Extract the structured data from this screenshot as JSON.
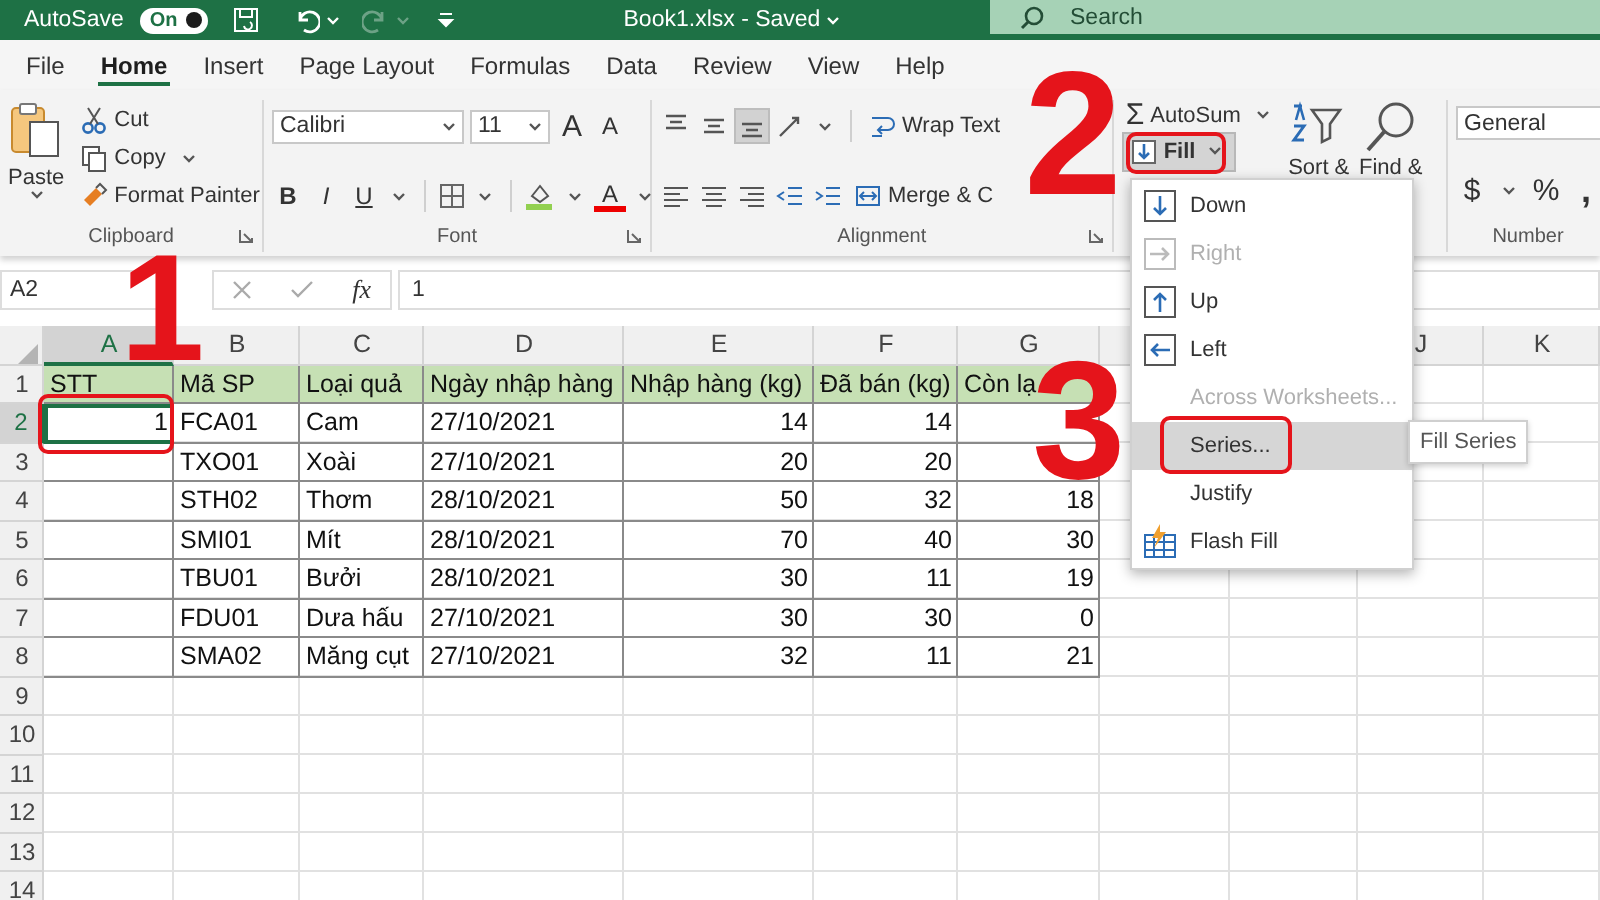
{
  "title_bar": {
    "autosave": {
      "label": "AutoSave",
      "toggle": "On",
      "on": true
    },
    "redo": {
      "disabled": true
    },
    "file_name": "Book1.xlsx - Saved",
    "search": {
      "placeholder": "Search"
    }
  },
  "tabs": [
    {
      "label": "File",
      "selected": false
    },
    {
      "label": "Home",
      "selected": true
    },
    {
      "label": "Insert",
      "selected": false
    },
    {
      "label": "Page Layout",
      "selected": false
    },
    {
      "label": "Formulas",
      "selected": false
    },
    {
      "label": "Data",
      "selected": false
    },
    {
      "label": "Review",
      "selected": false
    },
    {
      "label": "View",
      "selected": false
    },
    {
      "label": "Help",
      "selected": false
    }
  ],
  "ribbon": {
    "clipboard": {
      "label": "Clipboard",
      "paste": "Paste",
      "cut": "Cut",
      "copy": "Copy",
      "format_painter": "Format Painter"
    },
    "font": {
      "label": "Font",
      "font_name": "Calibri",
      "font_size": "11",
      "grow": "A",
      "shrink": "A",
      "bold": "B",
      "italic": "I",
      "underline": "U",
      "font_color": "A"
    },
    "alignment": {
      "label": "Alignment",
      "vertical": [
        {
          "kind": "top",
          "selected": false
        },
        {
          "kind": "middle",
          "selected": false
        },
        {
          "kind": "bottom",
          "selected": true
        }
      ],
      "wrap_text": "Wrap Text",
      "merge": "Merge & C"
    },
    "editing": {
      "autosum_symbol": "Σ",
      "autosum": "AutoSum",
      "fill": {
        "label": "Fill",
        "pressed": true
      },
      "sort": "Sort &",
      "find": "Find &"
    },
    "number": {
      "label": "Number",
      "format": "General",
      "currency": "$",
      "percent": "%",
      "comma": ","
    }
  },
  "formula_bar": {
    "name_box": "A2",
    "fx": "fx",
    "value": "1"
  },
  "sheet": {
    "columns": [
      "A",
      "B",
      "C",
      "D",
      "E",
      "F",
      "G"
    ],
    "columns_right": [
      "J",
      "K"
    ],
    "rows": [
      {
        "number": "1",
        "cells": [
          {
            "text": "STT",
            "kind": "header",
            "selected": false
          },
          {
            "text": "Mã SP",
            "kind": "header",
            "selected": false
          },
          {
            "text": "Loại quả",
            "kind": "header",
            "selected": false
          },
          {
            "text": "Ngày nhập hàng",
            "kind": "header",
            "selected": false
          },
          {
            "text": "Nhập hàng (kg)",
            "kind": "header",
            "selected": false
          },
          {
            "text": "Đã bán (kg)",
            "kind": "header",
            "selected": false
          },
          {
            "text": "Còn lạ",
            "kind": "header",
            "selected": false
          }
        ]
      },
      {
        "number": "2",
        "cells": [
          {
            "text": "1",
            "kind": "number",
            "selected": true
          },
          {
            "text": "FCA01",
            "kind": "text",
            "selected": false
          },
          {
            "text": "Cam",
            "kind": "text",
            "selected": false
          },
          {
            "text": "27/10/2021",
            "kind": "text",
            "selected": false
          },
          {
            "text": "14",
            "kind": "number",
            "selected": false
          },
          {
            "text": "14",
            "kind": "number",
            "selected": false
          },
          {
            "kind": "blank",
            "selected": false
          }
        ]
      },
      {
        "number": "3",
        "cells": [
          {
            "kind": "blank",
            "selected": false
          },
          {
            "text": "TXO01",
            "kind": "text",
            "selected": false
          },
          {
            "text": "Xoài",
            "kind": "text",
            "selected": false
          },
          {
            "text": "27/10/2021",
            "kind": "text",
            "selected": false
          },
          {
            "text": "20",
            "kind": "number",
            "selected": false
          },
          {
            "text": "20",
            "kind": "number",
            "selected": false
          },
          {
            "kind": "blank",
            "selected": false
          }
        ]
      },
      {
        "number": "4",
        "cells": [
          {
            "kind": "blank",
            "selected": false
          },
          {
            "text": "STH02",
            "kind": "text",
            "selected": false
          },
          {
            "text": "Thơm",
            "kind": "text",
            "selected": false
          },
          {
            "text": "28/10/2021",
            "kind": "text",
            "selected": false
          },
          {
            "text": "50",
            "kind": "number",
            "selected": false
          },
          {
            "text": "32",
            "kind": "number",
            "selected": false
          },
          {
            "text": "18",
            "kind": "number",
            "selected": false
          }
        ]
      },
      {
        "number": "5",
        "cells": [
          {
            "kind": "blank",
            "selected": false
          },
          {
            "text": "SMI01",
            "kind": "text",
            "selected": false
          },
          {
            "text": "Mít",
            "kind": "text",
            "selected": false
          },
          {
            "text": "28/10/2021",
            "kind": "text",
            "selected": false
          },
          {
            "text": "70",
            "kind": "number",
            "selected": false
          },
          {
            "text": "40",
            "kind": "number",
            "selected": false
          },
          {
            "text": "30",
            "kind": "number",
            "selected": false
          }
        ]
      },
      {
        "number": "6",
        "cells": [
          {
            "kind": "blank",
            "selected": false
          },
          {
            "text": "TBU01",
            "kind": "text",
            "selected": false
          },
          {
            "text": "Bưởi",
            "kind": "text",
            "selected": false
          },
          {
            "text": "28/10/2021",
            "kind": "text",
            "selected": false
          },
          {
            "text": "30",
            "kind": "number",
            "selected": false
          },
          {
            "text": "11",
            "kind": "number",
            "selected": false
          },
          {
            "text": "19",
            "kind": "number",
            "selected": false
          }
        ]
      },
      {
        "number": "7",
        "cells": [
          {
            "kind": "blank",
            "selected": false
          },
          {
            "text": "FDU01",
            "kind": "text",
            "selected": false
          },
          {
            "text": "Dưa hấu",
            "kind": "text",
            "selected": false
          },
          {
            "text": "27/10/2021",
            "kind": "text",
            "selected": false
          },
          {
            "text": "30",
            "kind": "number",
            "selected": false
          },
          {
            "text": "30",
            "kind": "number",
            "selected": false
          },
          {
            "text": "0",
            "kind": "number",
            "selected": false
          }
        ]
      },
      {
        "number": "8",
        "cells": [
          {
            "kind": "blank",
            "selected": false
          },
          {
            "text": "SMA02",
            "kind": "text",
            "selected": false
          },
          {
            "text": "Măng cụt",
            "kind": "text",
            "selected": false
          },
          {
            "text": "27/10/2021",
            "kind": "text",
            "selected": false
          },
          {
            "text": "32",
            "kind": "number",
            "selected": false
          },
          {
            "text": "11",
            "kind": "number",
            "selected": false
          },
          {
            "text": "21",
            "kind": "number",
            "selected": false
          }
        ]
      },
      {
        "number": "9"
      },
      {
        "number": "10"
      },
      {
        "number": "11"
      },
      {
        "number": "12"
      },
      {
        "number": "13"
      },
      {
        "number": "14"
      }
    ]
  },
  "fill_menu": {
    "items": [
      {
        "label": "Down",
        "kind": "down",
        "disabled": false,
        "selected": false
      },
      {
        "label": "Right",
        "kind": "right",
        "disabled": true,
        "selected": false
      },
      {
        "label": "Up",
        "kind": "up",
        "disabled": false,
        "selected": false
      },
      {
        "label": "Left",
        "kind": "left",
        "disabled": false,
        "selected": false
      },
      {
        "label": "Across Worksheets...",
        "kind": "plain",
        "disabled": true,
        "selected": false
      },
      {
        "label": "Series...",
        "kind": "plain",
        "disabled": false,
        "selected": true
      },
      {
        "label": "Justify",
        "kind": "plain",
        "disabled": false,
        "selected": false
      },
      {
        "label": "Flash Fill",
        "kind": "flash",
        "disabled": false,
        "selected": false
      }
    ]
  },
  "tooltip": "Fill Series",
  "annotations": [
    {
      "text": "1"
    },
    {
      "text": "2"
    },
    {
      "text": "3"
    }
  ]
}
